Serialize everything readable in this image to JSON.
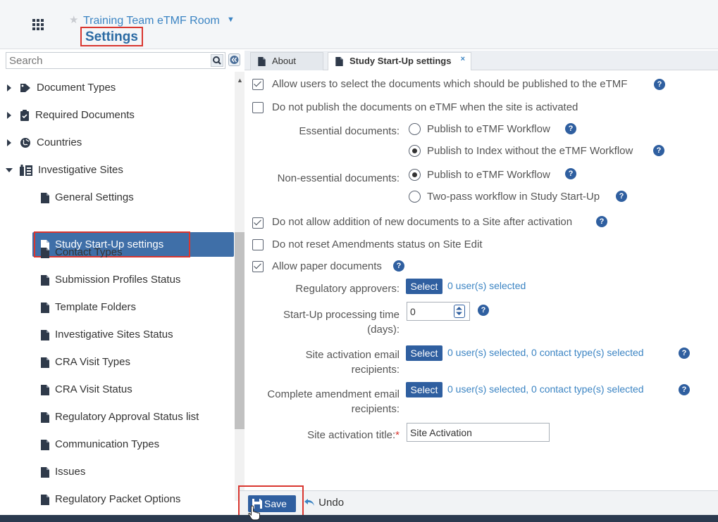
{
  "header": {
    "room_title": "Training Team eTMF Room",
    "page_title": "Settings"
  },
  "sidebar": {
    "search_placeholder": "Search",
    "items": [
      {
        "label": "Document Types"
      },
      {
        "label": "Required Documents"
      },
      {
        "label": "Countries"
      },
      {
        "label": "Investigative Sites"
      },
      {
        "label": "General Settings"
      },
      {
        "label": "Study Start-Up settings"
      },
      {
        "label": "Contact Types"
      },
      {
        "label": "Submission Profiles Status"
      },
      {
        "label": "Template Folders"
      },
      {
        "label": "Investigative Sites Status"
      },
      {
        "label": "CRA Visit Types"
      },
      {
        "label": "CRA Visit Status"
      },
      {
        "label": "Regulatory Approval Status list"
      },
      {
        "label": "Communication Types"
      },
      {
        "label": "Issues"
      },
      {
        "label": "Regulatory Packet Options"
      }
    ]
  },
  "tabs": {
    "about": "About",
    "ssu": "Study Start-Up settings",
    "close": "×"
  },
  "settings": {
    "allow_select_docs": "Allow users to select the documents which should be published to the eTMF",
    "do_not_publish": "Do not publish the documents on eTMF when the site is activated",
    "essential_label": "Essential documents:",
    "essential_opt1": "Publish to eTMF Workflow",
    "essential_opt2": "Publish to Index without the eTMF Workflow",
    "nonessential_label": "Non-essential documents:",
    "nonessential_opt1": "Publish to eTMF Workflow",
    "nonessential_opt2": "Two-pass workflow in Study Start-Up",
    "no_add_docs": "Do not allow addition of new documents to a Site after activation",
    "no_reset_amend": "Do not reset Amendments status on Site Edit",
    "allow_paper": "Allow paper documents",
    "reg_approvers_label": "Regulatory approvers:",
    "select_label": "Select",
    "reg_approvers_value": "0 user(s) selected",
    "processing_time_label_1": "Start-Up processing time",
    "processing_time_label_2": "(days):",
    "processing_time_value": "0",
    "site_activation_label_1": "Site activation email",
    "site_activation_label_2": "recipients:",
    "site_activation_value": "0 user(s) selected, 0 contact type(s) selected",
    "amendment_label_1": "Complete amendment email",
    "amendment_label_2": "recipients:",
    "amendment_value": "0 user(s) selected, 0 contact type(s) selected",
    "activation_title_label": "Site activation title:",
    "required_mark": "*",
    "activation_title_value": "Site Activation",
    "help": "?"
  },
  "footer": {
    "save": "Save",
    "undo": "Undo"
  },
  "colors": {
    "accent": "#2f5fa0",
    "link": "#3b84c3",
    "selected_bg": "#3f6fa8",
    "highlight_red": "#d9362f"
  }
}
